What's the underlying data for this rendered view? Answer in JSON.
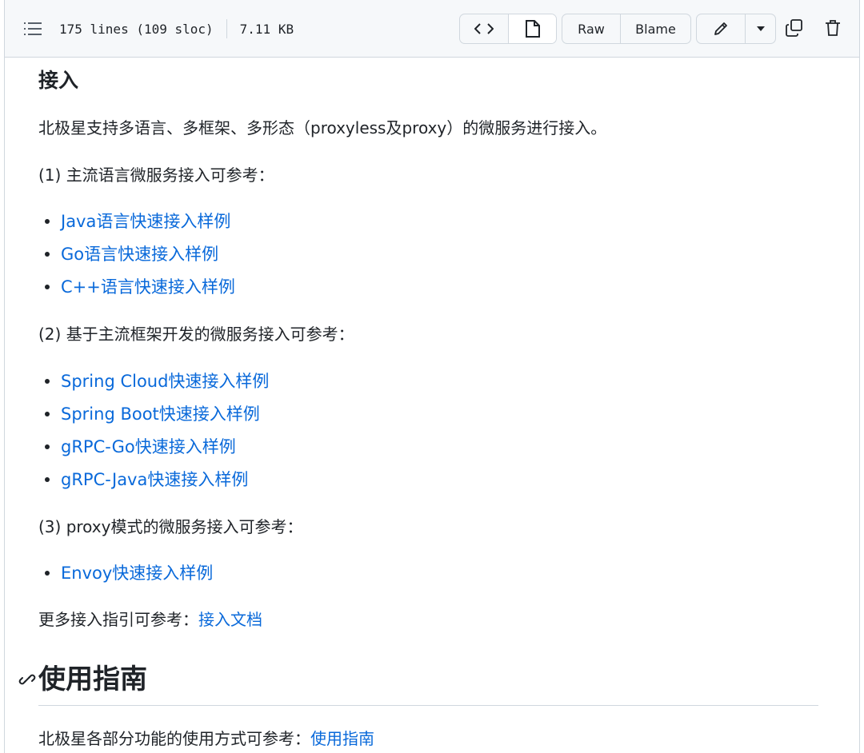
{
  "toolbar": {
    "lines": "175 lines (109 sloc)",
    "size": "7.11 KB",
    "raw_label": "Raw",
    "blame_label": "Blame"
  },
  "icons": {
    "outline": "list-unordered-icon",
    "code": "code-icon",
    "preview": "file-icon",
    "edit": "pencil-icon",
    "dropdown": "triangle-down-icon",
    "copy": "copy-icon",
    "delete": "trash-icon",
    "anchor": "link-icon"
  },
  "colors": {
    "link": "#0969da",
    "text": "#1f2328",
    "border": "#d0d7de",
    "toolbar_bg": "#f6f8fa"
  },
  "doc": {
    "heading": "接入",
    "intro": "北极星支持多语言、多框架、多形态（proxyless及proxy）的微服务进行接入。",
    "sec1": {
      "title": "(1) 主流语言微服务接入可参考：",
      "links": [
        "Java语言快速接入样例",
        "Go语言快速接入样例",
        "C++语言快速接入样例"
      ]
    },
    "sec2": {
      "title": "(2) 基于主流框架开发的微服务接入可参考：",
      "links": [
        "Spring Cloud快速接入样例",
        "Spring Boot快速接入样例",
        "gRPC-Go快速接入样例",
        "gRPC-Java快速接入样例"
      ]
    },
    "sec3": {
      "title": "(3) proxy模式的微服务接入可参考：",
      "links": [
        "Envoy快速接入样例"
      ]
    },
    "more_text": "更多接入指引可参考：",
    "more_link": "接入文档",
    "h2": "使用指南",
    "usage_text": "北极星各部分功能的使用方式可参考：",
    "usage_link": "使用指南"
  }
}
